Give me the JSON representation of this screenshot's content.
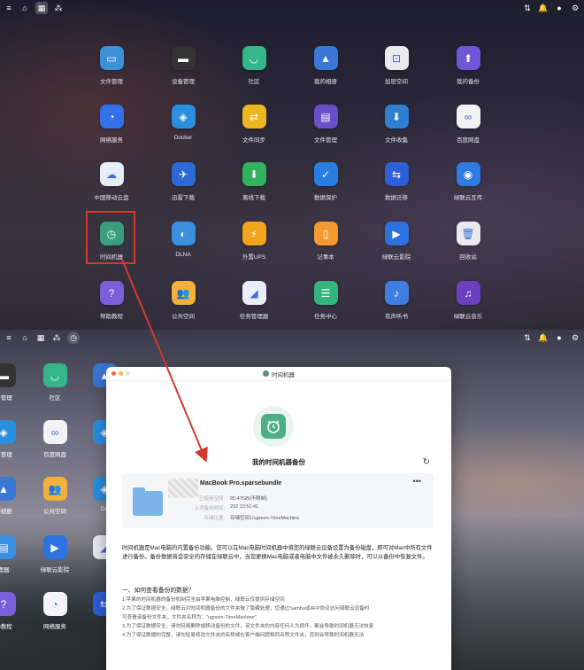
{
  "top_screen": {
    "apps": [
      {
        "label": "文件管理",
        "color": "#3d8fd8",
        "glyph": "▭"
      },
      {
        "label": "设备管理",
        "color": "#333333",
        "glyph": "▬"
      },
      {
        "label": "社区",
        "color": "#35b68a",
        "glyph": "◡"
      },
      {
        "label": "我的相册",
        "color": "#3a78d6",
        "glyph": "▲"
      },
      {
        "label": "加密空间",
        "color": "#e9e9ee",
        "glyph": "⊡"
      },
      {
        "label": "我的备份",
        "color": "#6f55d8",
        "glyph": "⬆"
      },
      {
        "label": "网络服务",
        "color": "#3271e8",
        "glyph": "◔"
      },
      {
        "label": "Docker",
        "color": "#2b8fe0",
        "glyph": "◈"
      },
      {
        "label": "文件同步",
        "color": "#f0b620",
        "glyph": "⇄"
      },
      {
        "label": "文件管理",
        "color": "#6a4fc8",
        "glyph": "▤"
      },
      {
        "label": "文件收集",
        "color": "#2e7fd0",
        "glyph": "⬇"
      },
      {
        "label": "百度网盘",
        "color": "#f2f2f4",
        "glyph": "∞"
      },
      {
        "label": "中国移动云盘",
        "color": "#e6eef8",
        "glyph": "☁"
      },
      {
        "label": "迅雷下载",
        "color": "#2d6ad6",
        "glyph": "✈"
      },
      {
        "label": "离线下载",
        "color": "#34b15e",
        "glyph": "⬇"
      },
      {
        "label": "数据保护",
        "color": "#2a7de0",
        "glyph": "✓"
      },
      {
        "label": "数据迁移",
        "color": "#2c5fd8",
        "glyph": "⇆"
      },
      {
        "label": "绿联云互传",
        "color": "#2f7be2",
        "glyph": "◉"
      },
      {
        "label": "时间机器",
        "color": "#3a9e7e",
        "glyph": "◷"
      },
      {
        "label": "DLNA",
        "color": "#3a8fe0",
        "glyph": "◐"
      },
      {
        "label": "外置UPS",
        "color": "#f3a41c",
        "glyph": "⚡"
      },
      {
        "label": "记事本",
        "color": "#f59a30",
        "glyph": "▯"
      },
      {
        "label": "绿联云影院",
        "color": "#2c72e0",
        "glyph": "▶"
      },
      {
        "label": "回收站",
        "color": "#e9e9ee",
        "glyph": "🗑"
      },
      {
        "label": "帮助教程",
        "color": "#7a5fd8",
        "glyph": "?"
      },
      {
        "label": "公共空间",
        "color": "#f3b13c",
        "glyph": "👥"
      },
      {
        "label": "任务管理器",
        "color": "#e9eef8",
        "glyph": "◢"
      },
      {
        "label": "任务中心",
        "color": "#36b57a",
        "glyph": "☰"
      },
      {
        "label": "有声听书",
        "color": "#3f7ee0",
        "glyph": "♪"
      },
      {
        "label": "绿联云音乐",
        "color": "#6c3ec0",
        "glyph": "♫"
      }
    ]
  },
  "bottom_screen": {
    "apps": [
      {
        "label": "备管理",
        "color": "#333333",
        "glyph": "▬"
      },
      {
        "label": "社区",
        "color": "#35b68a",
        "glyph": "◡"
      },
      {
        "label": "",
        "color": "#3a78d6",
        "glyph": "▲"
      },
      {
        "label": "备管理",
        "color": "#2b8fe0",
        "glyph": "◈"
      },
      {
        "label": "百度网盘",
        "color": "#f2f2f4",
        "glyph": "∞"
      },
      {
        "label": "",
        "color": "#2b8fe0",
        "glyph": "◈"
      },
      {
        "label": "的相册",
        "color": "#3a78d6",
        "glyph": "▲"
      },
      {
        "label": "公共空间",
        "color": "#f3b13c",
        "glyph": "👥"
      },
      {
        "label": "Do",
        "color": "#2b8fe0",
        "glyph": "◈"
      },
      {
        "label": "理器",
        "color": "#3a8fe0",
        "glyph": "▤"
      },
      {
        "label": "绿联云影院",
        "color": "#2c72e0",
        "glyph": "▶"
      },
      {
        "label": "",
        "color": "#e9eef8",
        "glyph": "◢"
      },
      {
        "label": "助教程",
        "color": "#7a5fd8",
        "glyph": "?"
      },
      {
        "label": "网络服务",
        "color": "#f4f4f6",
        "glyph": "◔"
      },
      {
        "label": "",
        "color": "#2c5fd8",
        "glyph": "⇆"
      }
    ]
  },
  "window": {
    "title": "时间机器",
    "backup_title": "我的时间机器备份",
    "card": {
      "name": "MacBook Pro.sparsebundle",
      "more": "•••",
      "rows": [
        {
          "key": "已使用空间:",
          "value": "95.47GB(不限制)"
        },
        {
          "key": "上次备份时间:",
          "value": "202   13:51:41"
        },
        {
          "key": "存储位置:",
          "value": "存储空间1/ugreen-TimeMachine"
        }
      ]
    },
    "description": "时间机器是Mac电脑的内置备份功能。您可以在Mac电脑时间机器中将您的绿联云设备设置为备份磁盘，即可对Mac中所有文件进行备份。备份数据将会安全的存储在绿联云中，当您更换Mac电脑或者电脑中文件被永久删除时，可以从备份中恢复文件。",
    "faq_title": "一、如何查看备份的数据？",
    "faq_items": [
      "1.苹果的时间机器的备份机制完全由苹果电脑控制，绿联云仅提供存储空间",
      "2.为了保证数据安全，绿联云对时间机器备份的文件夹做了隐藏处理，您通过Samba或AFP协议访问绿联云设备时",
      "可查看该备份文件夹，文件夹名称为：\"ugreen-TimeMachine\"",
      "3.为了保证数据安全，请勿轻易删除或移动备份的文件，该文件夹的内容任何人为损坏，都会导致时间机器无法恢复",
      "4.为了保证数据的完整，请勿轻易修改文件夹的名称或在客户端问题相同名称文件夹，否则会导致时间机器无法"
    ]
  }
}
